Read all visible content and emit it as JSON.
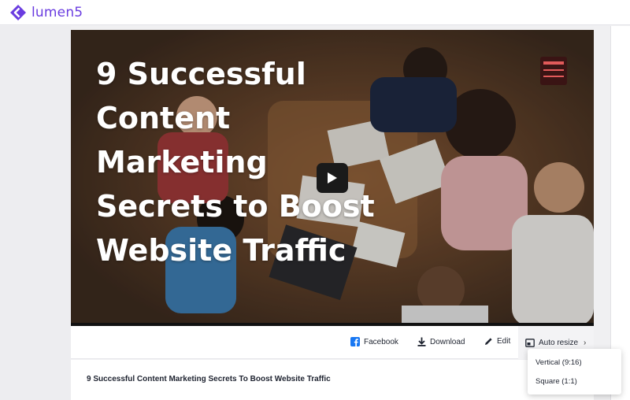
{
  "app": {
    "name": "lumen5",
    "brand_color": "#6a3ce0"
  },
  "video": {
    "title_text": "9 Successful Content Marketing Secrets to Boost Website Traffic",
    "play_icon": "play-icon"
  },
  "actions": {
    "facebook": {
      "label": "Facebook",
      "icon": "facebook-icon",
      "color": "#1877f2"
    },
    "download": {
      "label": "Download",
      "icon": "download-icon"
    },
    "edit": {
      "label": "Edit",
      "icon": "pencil-icon"
    },
    "auto_resize": {
      "label": "Auto resize",
      "icon": "resize-icon"
    }
  },
  "resize_menu": {
    "items": [
      {
        "label": "Vertical (9:16)"
      },
      {
        "label": "Square (1:1)"
      }
    ]
  },
  "description": {
    "title": "9 Successful Content Marketing Secrets To Boost Website Traffic"
  }
}
